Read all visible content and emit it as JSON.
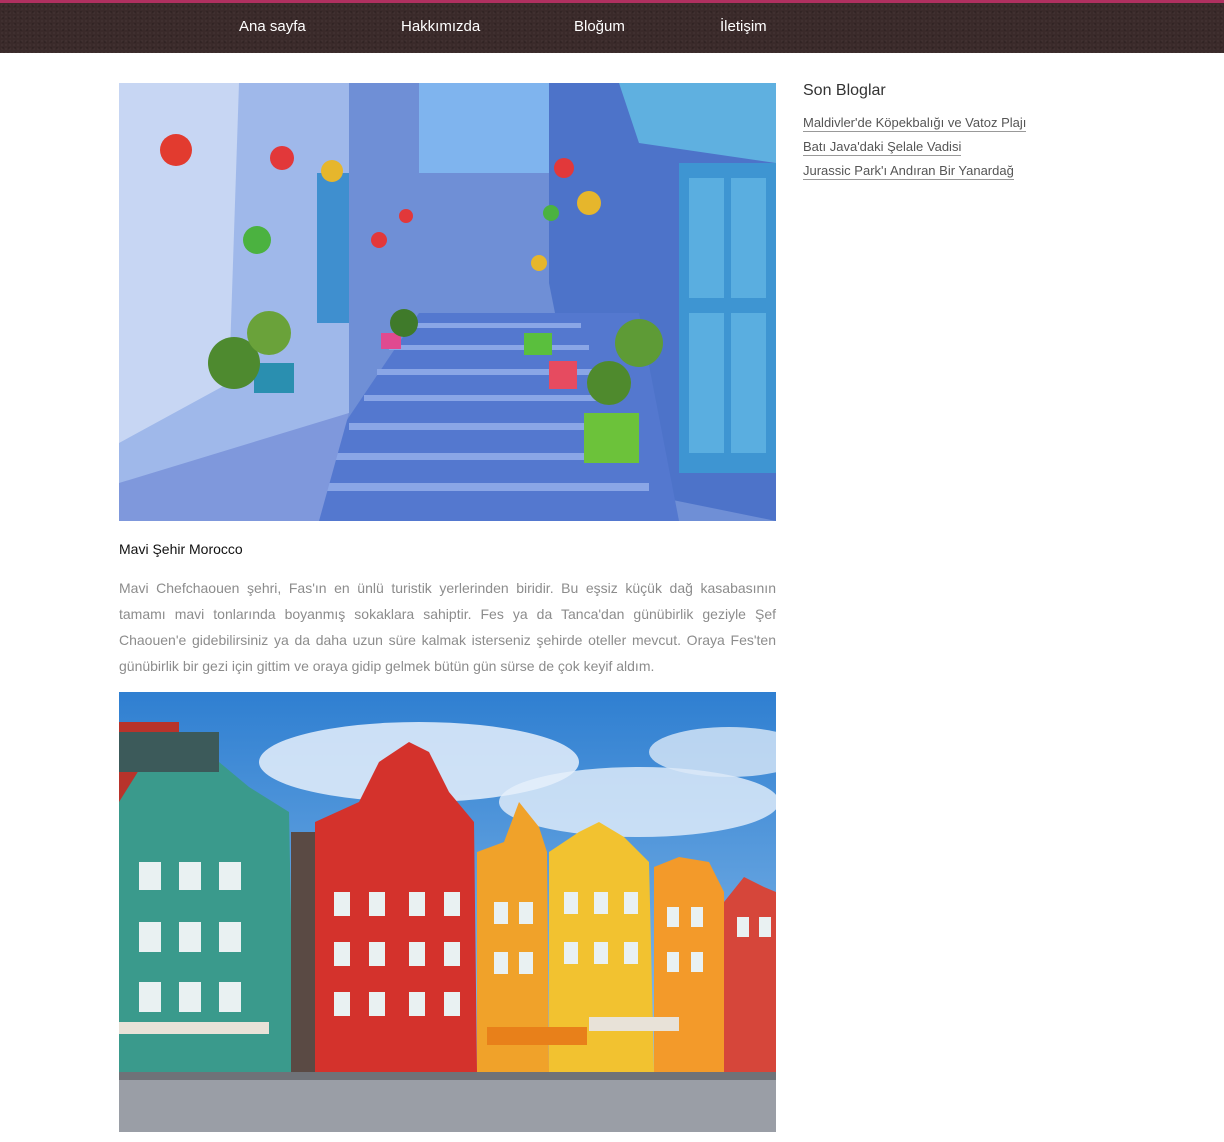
{
  "nav": {
    "items": [
      {
        "label": "Ana sayfa"
      },
      {
        "label": "Hakkımızda"
      },
      {
        "label": "Bloğum"
      },
      {
        "label": "İletişim"
      }
    ]
  },
  "posts": [
    {
      "title": "Mavi Şehir Morocco",
      "body": "Mavi Chefchaouen şehri, Fas'ın en ünlü turistik yerlerinden biridir. Bu eşsiz küçük dağ kasabasının tamamı mavi tonlarında boyanmış sokaklara sahiptir. Fes ya da Tanca'dan günübirlik geziyle Şef Chaouen'e gidebilirsiniz ya da daha uzun süre kalmak isterseniz şehirde oteller mevcut. Oraya Fes'ten günübirlik bir gezi için gittim ve oraya gidip gelmek bütün gün sürse de çok keyif aldım."
    }
  ],
  "sidebar": {
    "title": "Son Bloglar",
    "links": [
      {
        "label": "Maldivler'de Köpekbalığı ve Vatoz Plajı"
      },
      {
        "label": "Batı Java'daki Şelale Vadisi"
      },
      {
        "label": "Jurassic Park'ı Andıran Bir Yanardağ"
      }
    ]
  },
  "colors": {
    "topbar": "#3a2a2a",
    "topbar_accent": "#b03060",
    "body_text": "#8c8c8c"
  }
}
